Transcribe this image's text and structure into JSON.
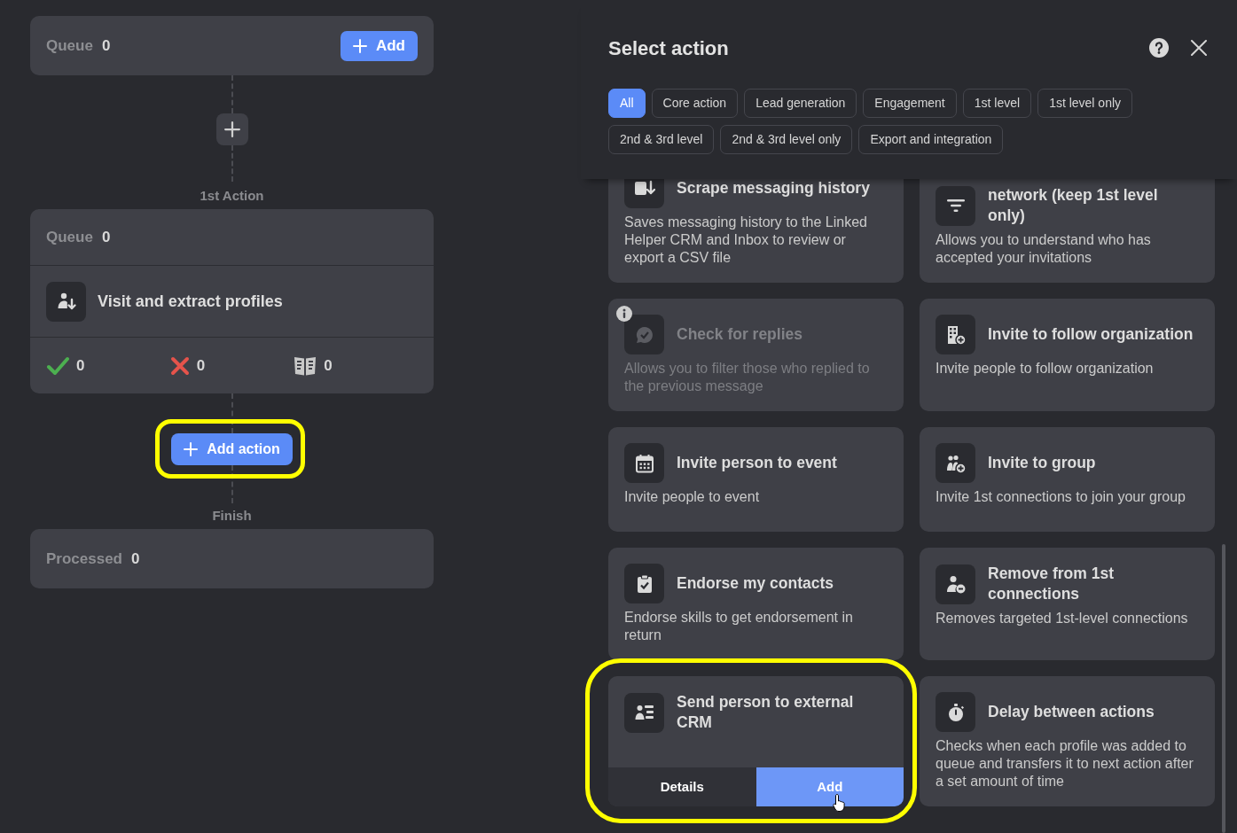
{
  "flow": {
    "start": {
      "label": "Queue",
      "count": "0",
      "button": "Add"
    },
    "steps": [
      {
        "caption": "1st Action",
        "queue_label": "Queue",
        "queue_count": "0",
        "title": "Visit and extract profiles",
        "stats": [
          {
            "kind": "check",
            "value": "0"
          },
          {
            "kind": "cross",
            "value": "0"
          },
          {
            "kind": "book",
            "value": "0"
          }
        ]
      }
    ],
    "add_action": {
      "label": "Add action",
      "highlighted": true
    },
    "finish": {
      "caption": "Finish",
      "label": "Processed",
      "count": "0"
    }
  },
  "panel": {
    "title": "Select action",
    "filters": [
      {
        "label": "All",
        "selected": true
      },
      {
        "label": "Core action",
        "selected": false
      },
      {
        "label": "Lead generation",
        "selected": false
      },
      {
        "label": "Engagement",
        "selected": false
      },
      {
        "label": "1st level",
        "selected": false
      },
      {
        "label": "1st level only",
        "selected": false
      },
      {
        "label": "2nd & 3rd level",
        "selected": false
      },
      {
        "label": "2nd & 3rd level only",
        "selected": false
      },
      {
        "label": "Export and integration",
        "selected": false
      }
    ],
    "actions": [
      {
        "title": "Scrape messaging history",
        "description": "Saves messaging history to the Linked Helper CRM and Inbox to review or export a CSV file",
        "disabled": false,
        "highlighted": false
      },
      {
        "title": "network (keep 1st level only)",
        "description": "Allows you to understand who has accepted your invitations",
        "disabled": false,
        "highlighted": false
      },
      {
        "title": "Check for replies",
        "description": "Allows you to filter those who replied to the previous message",
        "disabled": true,
        "highlighted": false
      },
      {
        "title": "Invite to follow organization",
        "description": "Invite people to follow organization",
        "disabled": false,
        "highlighted": false
      },
      {
        "title": "Invite person to event",
        "description": "Invite people to event",
        "disabled": false,
        "highlighted": false
      },
      {
        "title": "Invite to group",
        "description": "Invite 1st connections to join your group",
        "disabled": false,
        "highlighted": false
      },
      {
        "title": "Endorse my contacts",
        "description": "Endorse skills to get endorsement in return",
        "disabled": false,
        "highlighted": false
      },
      {
        "title": "Remove from 1st connections",
        "description": "Removes targeted 1st-level connections",
        "disabled": false,
        "highlighted": false
      },
      {
        "title": "Send person to external CRM",
        "disabled": false,
        "highlighted": true,
        "buttons": [
          {
            "label": "Details",
            "kind": "secondary",
            "hovered": false
          },
          {
            "label": "Add",
            "kind": "primary",
            "hovered": true
          }
        ]
      },
      {
        "title": "Delay between actions",
        "description": "Checks when each profile was added to queue and transfers it to next action after a set amount of time",
        "disabled": false,
        "highlighted": false
      }
    ]
  }
}
